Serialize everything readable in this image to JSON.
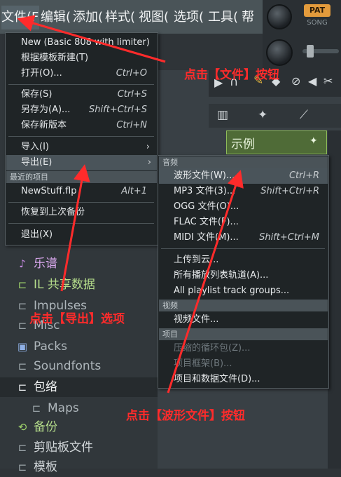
{
  "menubar": {
    "items": [
      "文件(F",
      "编辑(",
      "添加(",
      "样式(",
      "视图(",
      "选项(",
      "工具(",
      "帮"
    ]
  },
  "toolbar": {
    "pat_label": "PAT",
    "song_label": "SONG"
  },
  "file_menu": {
    "items": [
      {
        "label": "New (Basic 808 with limiter)",
        "shortcut": ""
      },
      {
        "label": "根据模板新建(T)",
        "shortcut": ""
      },
      {
        "label": "打开(O)...",
        "shortcut": "Ctrl+O"
      },
      {
        "label": "保存(S)",
        "shortcut": "Ctrl+S"
      },
      {
        "label": "另存为(A)...",
        "shortcut": "Shift+Ctrl+S"
      },
      {
        "label": "保存新版本",
        "shortcut": "Ctrl+N"
      },
      {
        "label": "导入(I)",
        "shortcut": ""
      },
      {
        "label": "导出(E)",
        "shortcut": ""
      },
      {
        "label": "NewStuff.flp",
        "shortcut": "Alt+1"
      },
      {
        "label": "恢复到上次备份",
        "shortcut": ""
      },
      {
        "label": "退出(X)",
        "shortcut": ""
      }
    ],
    "recent_header": "最近的项目"
  },
  "export_menu": {
    "audio_header": "音频",
    "video_header": "视频",
    "project_header": "项目",
    "items": [
      {
        "label": "波形文件(W)...",
        "shortcut": "Ctrl+R"
      },
      {
        "label": "MP3 文件(3)...",
        "shortcut": "Shift+Ctrl+R"
      },
      {
        "label": "OGG 文件(O)...",
        "shortcut": ""
      },
      {
        "label": "FLAC 文件(F)...",
        "shortcut": ""
      },
      {
        "label": "MIDI 文件(M)...",
        "shortcut": "Shift+Ctrl+M"
      },
      {
        "label": "上传到云...",
        "shortcut": ""
      },
      {
        "label": "所有播放列表轨道(A)...",
        "shortcut": ""
      },
      {
        "label": "All playlist track groups...",
        "shortcut": ""
      },
      {
        "label": "视频文件...",
        "shortcut": ""
      },
      {
        "label": "压缩的循环包(Z)...",
        "shortcut": ""
      },
      {
        "label": "项目框架(B)...",
        "shortcut": ""
      },
      {
        "label": "项目和数据文件(D)...",
        "shortcut": ""
      }
    ]
  },
  "browser": {
    "items": [
      "乐谱",
      "IL 共享数据",
      "Impulses",
      "Misc",
      "Packs",
      "Soundfonts",
      "包络",
      "Maps",
      "备份",
      "剪贴板文件",
      "模板"
    ]
  },
  "pattern": {
    "name": "示例"
  },
  "annotations": {
    "file_btn": "点击【文件】按钮",
    "export_opt": "点击【导出】选项",
    "wave_btn": "点击【波形文件】按钮"
  },
  "colors": {
    "annotation": "#ff2b2b",
    "pattern_green": "#4f6b37",
    "pat_orange": "#e39b3c"
  }
}
